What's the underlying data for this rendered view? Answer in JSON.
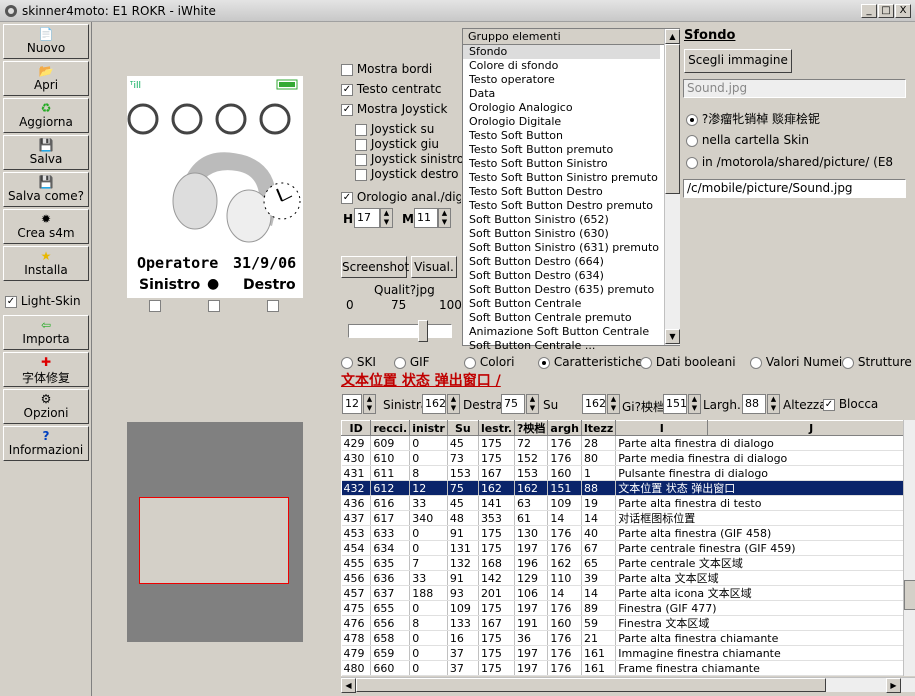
{
  "window": {
    "title": "skinner4moto: E1 ROKR - iWhite",
    "btn_min": "_",
    "btn_max": "□",
    "btn_close": "X"
  },
  "sidebar": {
    "items": [
      {
        "label": "Nuovo",
        "icon": "📄",
        "icon_name": "new-file-icon"
      },
      {
        "label": "Apri",
        "icon": "📂",
        "icon_name": "open-folder-icon"
      },
      {
        "label": "Aggiorna",
        "icon": "♻",
        "icon_name": "refresh-icon"
      },
      {
        "label": "Salva",
        "icon": "💾",
        "icon_name": "save-icon"
      },
      {
        "label": "Salva come?",
        "icon": "💾",
        "icon_name": "save-as-icon"
      },
      {
        "label": "Crea s4m",
        "icon": "✹",
        "icon_name": "create-icon"
      },
      {
        "label": "Installa",
        "icon": "★",
        "icon_name": "install-icon"
      }
    ],
    "light_skin": "Light-Skin",
    "items2": [
      {
        "label": "Importa",
        "icon": "⇦",
        "icon_name": "import-icon"
      },
      {
        "label": "字体修复",
        "icon": "✚",
        "icon_name": "repair-icon"
      },
      {
        "label": "Opzioni",
        "icon": "⚙",
        "icon_name": "options-icon"
      },
      {
        "label": "Informazioni",
        "icon": "?",
        "icon_name": "info-icon"
      }
    ]
  },
  "phone": {
    "operator": "Operatore",
    "date": "31/9/06",
    "left_soft": "Sinistro",
    "right_soft": "Destro"
  },
  "options": {
    "mostra_bordi": "Mostra bordi",
    "testo_centrato": "Testo centratc",
    "mostra_joystick": "Mostra Joystick",
    "joy_su": "Joystick su",
    "joy_giu": "Joystick giu",
    "joy_sinistro": "Joystick sinistro",
    "joy_destro": "Joystick destro",
    "orologio": "Orologio anal./digit",
    "h_label": "H",
    "h_value": "17",
    "m_label": "M",
    "m_value": "11",
    "screenshot": "Screenshot",
    "visual": "Visual.",
    "quality_label": "Qualit?jpg",
    "q0": "0",
    "q75": "75",
    "q100": "100",
    "quality_value": 75
  },
  "list": {
    "header": "Gruppo elementi",
    "items": [
      "Sfondo",
      "Colore di sfondo",
      "Testo operatore",
      "Data",
      "Orologio Analogico",
      "Orologio Digitale",
      "Testo Soft Button",
      "Testo Soft Button premuto",
      "Testo Soft Button Sinistro",
      "Testo Soft Button Sinistro premuto",
      "Testo Soft Button Destro",
      "Testo Soft Button Destro premuto",
      "Soft Button Sinistro (652)",
      "Soft Button Sinistro (630)",
      "Soft Button Sinistro (631) premuto",
      "Soft Button Destro (664)",
      "Soft Button Destro (634)",
      "Soft Button Destro (635) premuto",
      "Soft Button Centrale",
      "Soft Button Centrale premuto",
      "Animazione Soft Button Centrale",
      "Soft Button Centrale ..."
    ]
  },
  "sfondo": {
    "title": "Sfondo",
    "choose": "Scegli immagine",
    "filename": "Sound.jpg",
    "opt1": "?渗瘤牝销棹 赕痱桧铌",
    "opt2": "nella cartella Skin",
    "opt3": "in /motorola/shared/picture/ (E8",
    "path": "/c/mobile/picture/Sound.jpg"
  },
  "tabs": [
    "SKI",
    "GIF",
    "Colori",
    "Caratteristiche",
    "Dati booleani",
    "Valori Numei",
    "Strutture"
  ],
  "tab_selected": 3,
  "section_title": "文本位置 状态 弹出窗口 /",
  "fields": {
    "v1": "12",
    "l1": "Sinistra",
    "v2": "162",
    "l2": "Destra",
    "v3": "75",
    "l3": "Su",
    "v4": "162",
    "l4": "Gi?柍档",
    "v5": "151",
    "l5": "Largh.",
    "v6": "88",
    "l6": "Altezza",
    "blocca": "Blocca"
  },
  "table": {
    "columns": [
      "ID",
      "recci.",
      "inistr",
      "Su",
      "lestr.",
      "?柍档",
      "argh",
      "ltezz",
      "I",
      "J"
    ],
    "rows": [
      [
        "429",
        "609",
        "0",
        "45",
        "175",
        "72",
        "176",
        "28",
        "Parte alta finestra di dialogo"
      ],
      [
        "430",
        "610",
        "0",
        "73",
        "175",
        "152",
        "176",
        "80",
        "Parte media finestra di dialogo"
      ],
      [
        "431",
        "611",
        "8",
        "153",
        "167",
        "153",
        "160",
        "1",
        "Pulsante finestra di dialogo"
      ],
      [
        "432",
        "612",
        "12",
        "75",
        "162",
        "162",
        "151",
        "88",
        "文本位置 状态 弹出窗口"
      ],
      [
        "436",
        "616",
        "33",
        "45",
        "141",
        "63",
        "109",
        "19",
        "Parte alta finestra di testo"
      ],
      [
        "437",
        "617",
        "340",
        "48",
        "353",
        "61",
        "14",
        "14",
        "对话框图标位置"
      ],
      [
        "453",
        "633",
        "0",
        "91",
        "175",
        "130",
        "176",
        "40",
        "Parte alta finestra (GIF 458)"
      ],
      [
        "454",
        "634",
        "0",
        "131",
        "175",
        "197",
        "176",
        "67",
        "Parte centrale finestra (GIF 459)"
      ],
      [
        "455",
        "635",
        "7",
        "132",
        "168",
        "196",
        "162",
        "65",
        "Parte centrale 文本区域"
      ],
      [
        "456",
        "636",
        "33",
        "91",
        "142",
        "129",
        "110",
        "39",
        "Parte alta 文本区域"
      ],
      [
        "457",
        "637",
        "188",
        "93",
        "201",
        "106",
        "14",
        "14",
        "Parte alta icona 文本区域"
      ],
      [
        "475",
        "655",
        "0",
        "109",
        "175",
        "197",
        "176",
        "89",
        "Finestra (GIF 477)"
      ],
      [
        "476",
        "656",
        "8",
        "133",
        "167",
        "191",
        "160",
        "59",
        "Finestra 文本区域"
      ],
      [
        "478",
        "658",
        "0",
        "16",
        "175",
        "36",
        "176",
        "21",
        "Parte alta finestra chiamante"
      ],
      [
        "479",
        "659",
        "0",
        "37",
        "175",
        "197",
        "176",
        "161",
        "Immagine finestra chiamante"
      ],
      [
        "480",
        "660",
        "0",
        "37",
        "175",
        "197",
        "176",
        "161",
        "Frame finestra chiamante"
      ]
    ],
    "selected_row": 3
  }
}
